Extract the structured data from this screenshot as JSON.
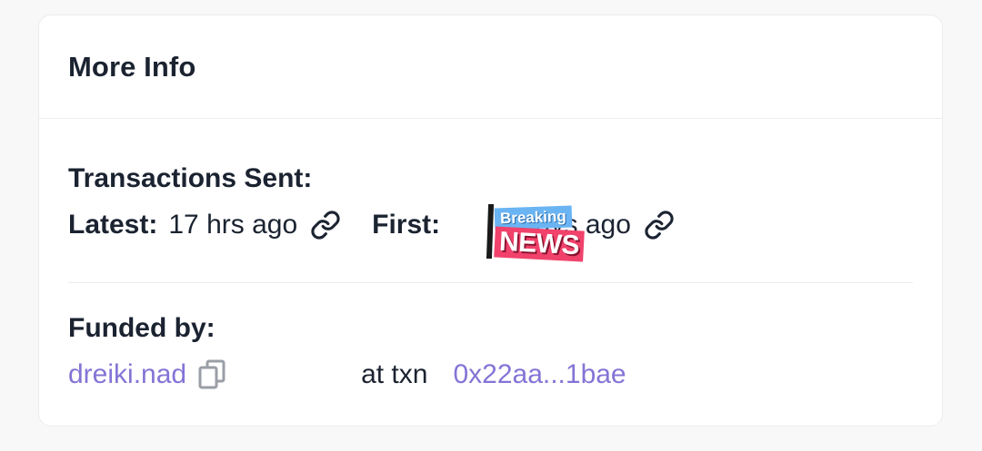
{
  "card": {
    "title": "More Info"
  },
  "transactions": {
    "heading": "Transactions Sent:",
    "latest_label": "Latest:",
    "latest_value": "17 hrs ago",
    "first_label": "First:",
    "first_value": "days ago"
  },
  "sticker": {
    "top_text": "Breaking",
    "bottom_text": "NEWS"
  },
  "funding": {
    "heading": "Funded by:",
    "funder": "dreiki.nad",
    "at_txn_label": "at txn",
    "txn_hash": "0x22aa...1bae"
  },
  "colors": {
    "text": "#1b2331",
    "link": "#8474d6",
    "icon": "#9a9ea6",
    "divider": "#ececee"
  },
  "icons": {
    "latest_link": "link-icon",
    "first_link": "link-icon",
    "copy": "copy-icon"
  }
}
